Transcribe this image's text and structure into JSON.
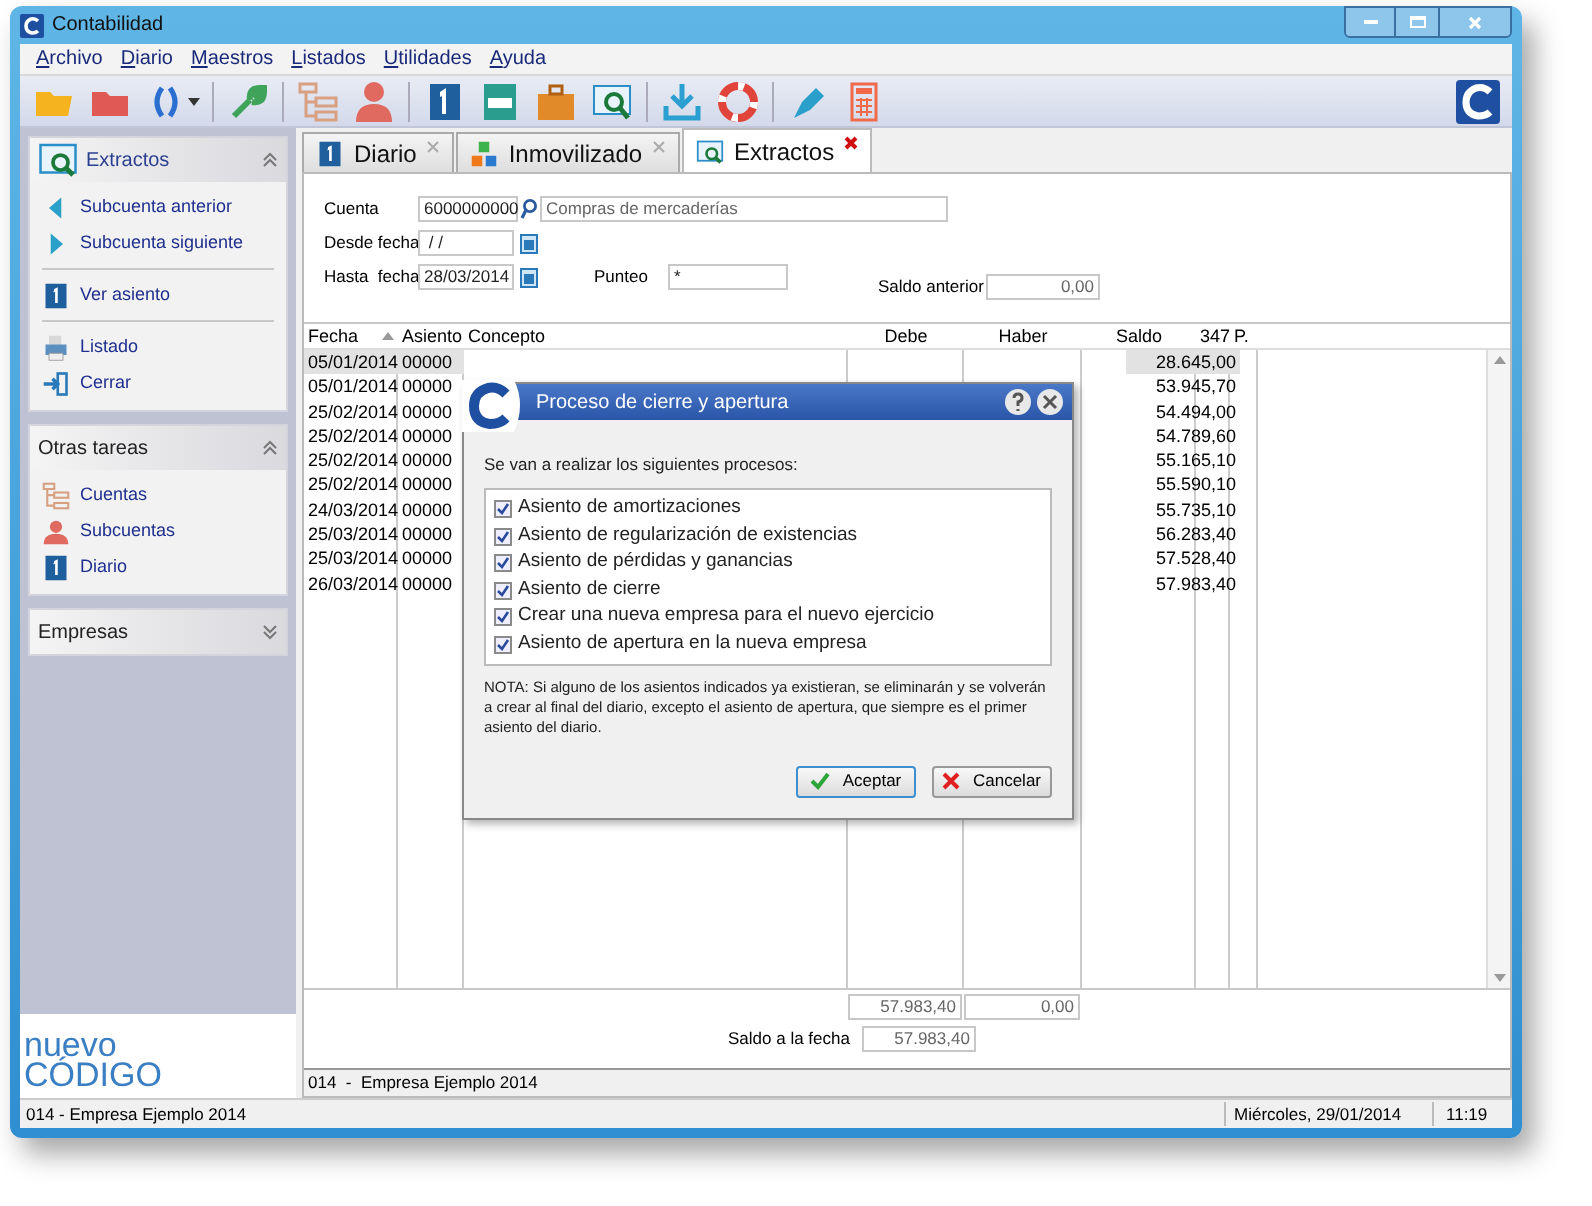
{
  "window": {
    "title": "Contabilidad"
  },
  "menu": [
    {
      "label": "Archivo"
    },
    {
      "label": "Diario"
    },
    {
      "label": "Maestros"
    },
    {
      "label": "Listados"
    },
    {
      "label": "Utilidades"
    },
    {
      "label": "Ayuda"
    }
  ],
  "sidebar": {
    "panels": [
      {
        "title": "Extractos",
        "expanded": true,
        "kind": "search",
        "groups": [
          [
            {
              "label": "Subcuenta anterior",
              "kind": "prev"
            },
            {
              "label": "Subcuenta siguiente",
              "kind": "next"
            }
          ],
          [
            {
              "label": "Ver asiento",
              "kind": "journal"
            }
          ],
          [
            {
              "label": "Listado",
              "kind": "print"
            },
            {
              "label": "Cerrar",
              "kind": "exit"
            }
          ]
        ]
      },
      {
        "title": "Otras tareas",
        "expanded": true,
        "kind": "none",
        "groups": [
          [
            {
              "label": "Cuentas",
              "kind": "tree"
            },
            {
              "label": "Subcuentas",
              "kind": "person"
            },
            {
              "label": "Diario",
              "kind": "journal"
            }
          ]
        ]
      },
      {
        "title": "Empresas",
        "expanded": false,
        "kind": "none"
      }
    ]
  },
  "logo": {
    "word_1": "nuevo",
    "word_2": "CÓDIGO"
  },
  "tabs": [
    {
      "label": "Diario",
      "kind": "journal",
      "selected": false
    },
    {
      "label": "Inmovilizado",
      "kind": "blocks",
      "selected": false
    },
    {
      "label": "Extractos",
      "kind": "search",
      "selected": true
    }
  ],
  "form": {
    "cuenta": {
      "label": "Cuenta",
      "value": "6000000000",
      "description": "Compras de mercaderías"
    },
    "desde": {
      "label": "Desde fecha",
      "value": " / /"
    },
    "hasta": {
      "label": "Hasta  fecha",
      "value": "28/03/2014"
    },
    "punteo": {
      "label": "Punteo",
      "value": "*"
    },
    "saldo_anterior": {
      "label": "Saldo anterior",
      "value": "0,00"
    }
  },
  "table": {
    "columns": [
      "Fecha",
      "Asiento",
      "Concepto",
      "Debe",
      "Haber",
      "Saldo",
      "347",
      "P."
    ],
    "rows": [
      {
        "fecha": "05/01/2014",
        "asiento": "00000",
        "saldo": "28.645,00",
        "selected": true
      },
      {
        "fecha": "05/01/2014",
        "asiento": "00000",
        "saldo": "53.945,70",
        "selected": false
      },
      {
        "fecha": "25/02/2014",
        "asiento": "00000",
        "saldo": "54.494,00",
        "selected": false
      },
      {
        "fecha": "25/02/2014",
        "asiento": "00000",
        "saldo": "54.789,60",
        "selected": false
      },
      {
        "fecha": "25/02/2014",
        "asiento": "00000",
        "saldo": "55.165,10",
        "selected": false
      },
      {
        "fecha": "25/02/2014",
        "asiento": "00000",
        "saldo": "55.590,10",
        "selected": false
      },
      {
        "fecha": "24/03/2014",
        "asiento": "00000",
        "saldo": "55.735,10",
        "selected": false
      },
      {
        "fecha": "25/03/2014",
        "asiento": "00000",
        "saldo": "56.283,40",
        "selected": false
      },
      {
        "fecha": "25/03/2014",
        "asiento": "00000",
        "saldo": "57.528,40",
        "selected": false
      },
      {
        "fecha": "26/03/2014",
        "asiento": "00000",
        "saldo": "57.983,40",
        "selected": false
      }
    ]
  },
  "totals": {
    "debe": "57.983,40",
    "haber": "0,00",
    "saldo_label": "Saldo a la fecha",
    "saldo": "57.983,40"
  },
  "company_line": "014  -  Empresa Ejemplo 2014",
  "status_bar": {
    "company": "014 - Empresa Ejemplo 2014",
    "date": "Miércoles, 29/01/2014",
    "time": "11:19"
  },
  "dialog": {
    "title": "Proceso de cierre y apertura",
    "intro": "Se van a realizar los siguientes procesos:",
    "processes": [
      {
        "label": "Asiento de amortizaciones",
        "checked": true
      },
      {
        "label": "Asiento de regularización de existencias",
        "checked": true
      },
      {
        "label": "Asiento de pérdidas y ganancias",
        "checked": true
      },
      {
        "label": "Asiento de cierre",
        "checked": true
      },
      {
        "label": "Crear una nueva empresa para el nuevo ejercicio",
        "checked": true
      },
      {
        "label": "Asiento de apertura en la nueva empresa",
        "checked": true
      }
    ],
    "note": "NOTA: Si alguno de los asientos indicados ya existieran, se eliminarán y se volverán a crear al final del diario, excepto el asiento de apertura, que siempre es el primer asiento del diario.",
    "buttons": [
      {
        "label": "Aceptar",
        "kind": "ok"
      },
      {
        "label": "Cancelar",
        "kind": "cancel"
      }
    ]
  }
}
